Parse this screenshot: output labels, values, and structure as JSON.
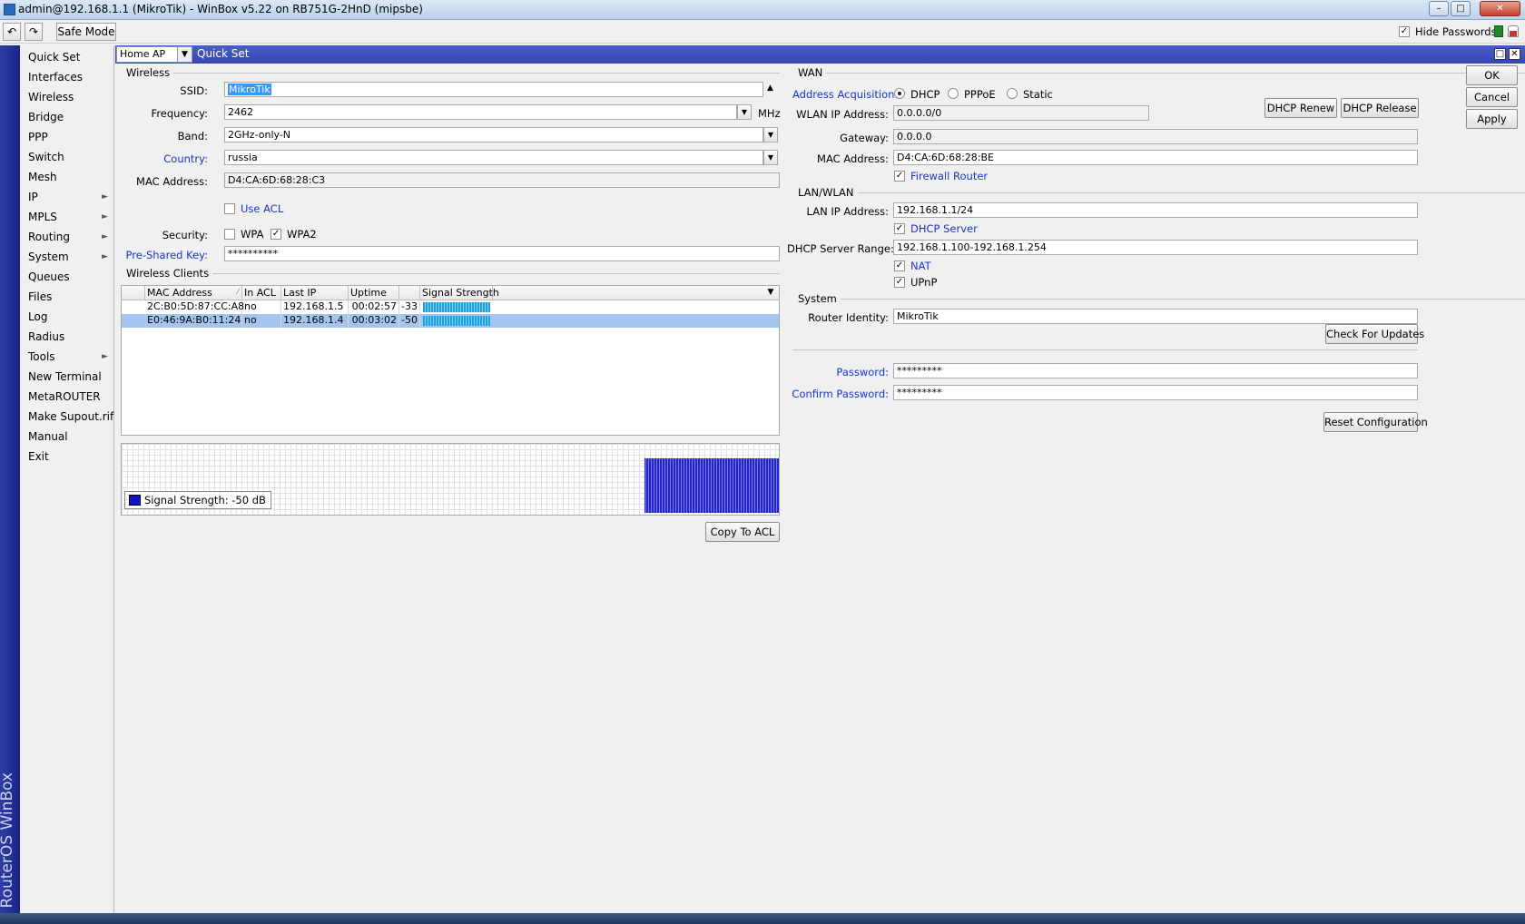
{
  "window": {
    "title": "admin@192.168.1.1 (MikroTik) - WinBox v5.22 on RB751G-2HnD (mipsbe)"
  },
  "toolbar": {
    "undo_icon": "undo-icon",
    "redo_icon": "redo-icon",
    "safe_mode": "Safe Mode",
    "hide_passwords": "Hide Passwords",
    "hide_passwords_checked": true
  },
  "brand": "RouterOS WinBox",
  "sidebar": {
    "items": [
      {
        "label": "Quick Set"
      },
      {
        "label": "Interfaces"
      },
      {
        "label": "Wireless"
      },
      {
        "label": "Bridge"
      },
      {
        "label": "PPP"
      },
      {
        "label": "Switch"
      },
      {
        "label": "Mesh"
      },
      {
        "label": "IP",
        "submenu": true
      },
      {
        "label": "MPLS",
        "submenu": true
      },
      {
        "label": "Routing",
        "submenu": true
      },
      {
        "label": "System",
        "submenu": true
      },
      {
        "label": "Queues"
      },
      {
        "label": "Files"
      },
      {
        "label": "Log"
      },
      {
        "label": "Radius"
      },
      {
        "label": "Tools",
        "submenu": true
      },
      {
        "label": "New Terminal"
      },
      {
        "label": "MetaROUTER"
      },
      {
        "label": "Make Supout.rif"
      },
      {
        "label": "Manual"
      },
      {
        "label": "Exit"
      }
    ]
  },
  "quickset": {
    "mode": "Home AP",
    "title": "Quick Set",
    "wireless": {
      "section": "Wireless",
      "ssid_label": "SSID:",
      "ssid": "MikroTik",
      "frequency_label": "Frequency:",
      "frequency": "2462",
      "frequency_unit": "MHz",
      "band_label": "Band:",
      "band": "2GHz-only-N",
      "country_label": "Country:",
      "country": "russia",
      "mac_label": "MAC Address:",
      "mac": "D4:CA:6D:68:28:C3",
      "use_acl": "Use ACL",
      "security_label": "Security:",
      "wpa": "WPA",
      "wpa2": "WPA2",
      "psk_label": "Pre-Shared Key:",
      "psk": "**********"
    },
    "clients": {
      "section": "Wireless Clients",
      "columns": [
        "MAC Address",
        "In ACL",
        "Last IP",
        "Uptime",
        "",
        "Signal Strength"
      ],
      "rows": [
        {
          "mac": "2C:B0:5D:87:CC:A8",
          "in_acl": "no",
          "last_ip": "192.168.1.5",
          "uptime": "00:02:57",
          "signal": "-33"
        },
        {
          "mac": "E0:46:9A:B0:11:24",
          "in_acl": "no",
          "last_ip": "192.168.1.4",
          "uptime": "00:03:02",
          "signal": "-50"
        }
      ],
      "legend": "Signal Strength:  -50 dB",
      "legend_color": "#1010d0",
      "copy_to_acl": "Copy To ACL"
    },
    "wan": {
      "section": "WAN",
      "acq_label": "Address Acquisition:",
      "dhcp": "DHCP",
      "pppoe": "PPPoE",
      "static": "Static",
      "selected": "DHCP",
      "wlan_ip_label": "WLAN IP Address:",
      "wlan_ip": "0.0.0.0/0",
      "dhcp_renew": "DHCP Renew",
      "dhcp_release": "DHCP Release",
      "gateway_label": "Gateway:",
      "gateway": "0.0.0.0",
      "mac_label": "MAC Address:",
      "mac": "D4:CA:6D:68:28:BE",
      "firewall_router": "Firewall Router"
    },
    "lan": {
      "section": "LAN/WLAN",
      "lan_ip_label": "LAN IP Address:",
      "lan_ip": "192.168.1.1/24",
      "dhcp_server": "DHCP Server",
      "range_label": "DHCP Server Range:",
      "range": "192.168.1.100-192.168.1.254",
      "nat": "NAT",
      "upnp": "UPnP"
    },
    "system": {
      "section": "System",
      "identity_label": "Router Identity:",
      "identity": "MikroTik",
      "check_updates": "Check For Updates",
      "password_label": "Password:",
      "password": "*********",
      "confirm_label": "Confirm Password:",
      "confirm": "*********",
      "reset": "Reset Configuration"
    },
    "actions": {
      "ok": "OK",
      "cancel": "Cancel",
      "apply": "Apply"
    }
  }
}
